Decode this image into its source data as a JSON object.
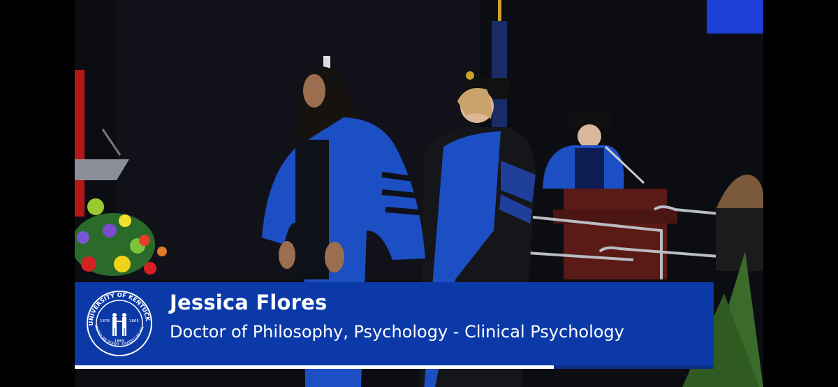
{
  "lower_third": {
    "name": "Jessica Flores",
    "degree": "Doctor of Philosophy, Psychology - Clinical Psychology"
  },
  "seal": {
    "icon": "university-seal-icon",
    "lettering_top": "UNIVERSITY OF KENTUCKY",
    "lettering_bottom": "UNITED WE STAND · DIVIDED WE FALL",
    "year_left": "1878",
    "year_right": "1865",
    "year_center": "1865"
  },
  "progress": {
    "fraction": 0.75
  },
  "colors": {
    "banner_blue": "#0b3aa8",
    "gown_blue": "#1d4fc4",
    "text": "#ffffff",
    "background": "#000000"
  }
}
